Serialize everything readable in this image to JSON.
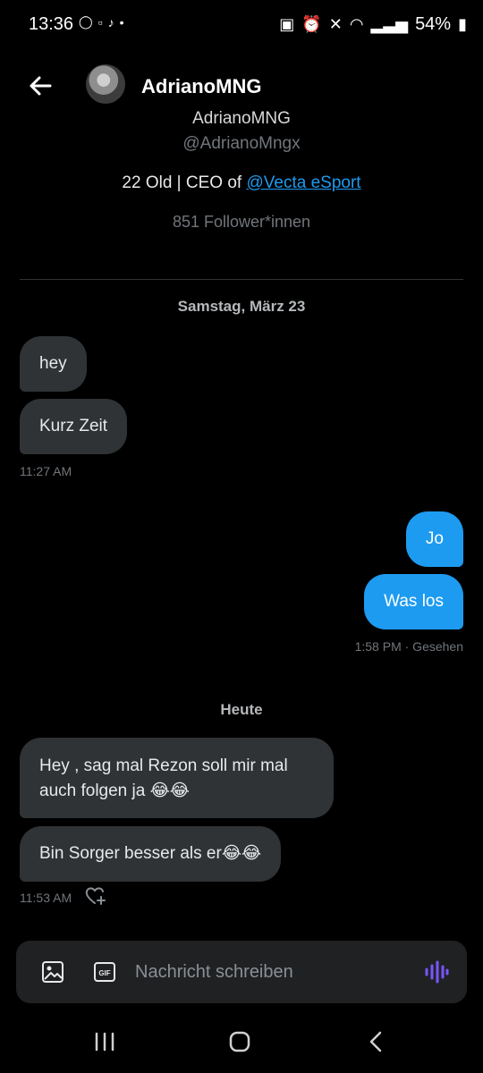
{
  "status_bar": {
    "time": "13:36",
    "battery": "54%",
    "accent": "#ffffff"
  },
  "header": {
    "title": "AdrianoMNG"
  },
  "profile": {
    "name": "AdrianoMNG",
    "handle": "@AdrianoMngx",
    "bio_prefix": "22 Old | CEO of ",
    "bio_link": "@Vecta eSport",
    "followers": "851 Follower*innen"
  },
  "conversation": {
    "sections": [
      {
        "date": "Samstag, März 23",
        "incoming": [
          "hey",
          "Kurz Zeit"
        ],
        "incoming_time": "11:27 AM",
        "outgoing": [
          "Jo",
          "Was los"
        ],
        "outgoing_time": "1:58 PM · Gesehen"
      },
      {
        "date": "Heute",
        "incoming": [
          "Hey , sag mal Rezon soll mir mal auch folgen ja 😂😂",
          "Bin Sorger besser als er😂😂"
        ],
        "incoming_time": "11:53 AM"
      }
    ]
  },
  "composer": {
    "placeholder": "Nachricht schreiben",
    "gif_label": "GIF"
  },
  "colors": {
    "incoming_bubble": "#2f3336",
    "outgoing_bubble": "#1d9bf0",
    "mic_accent": "#7856ff"
  }
}
